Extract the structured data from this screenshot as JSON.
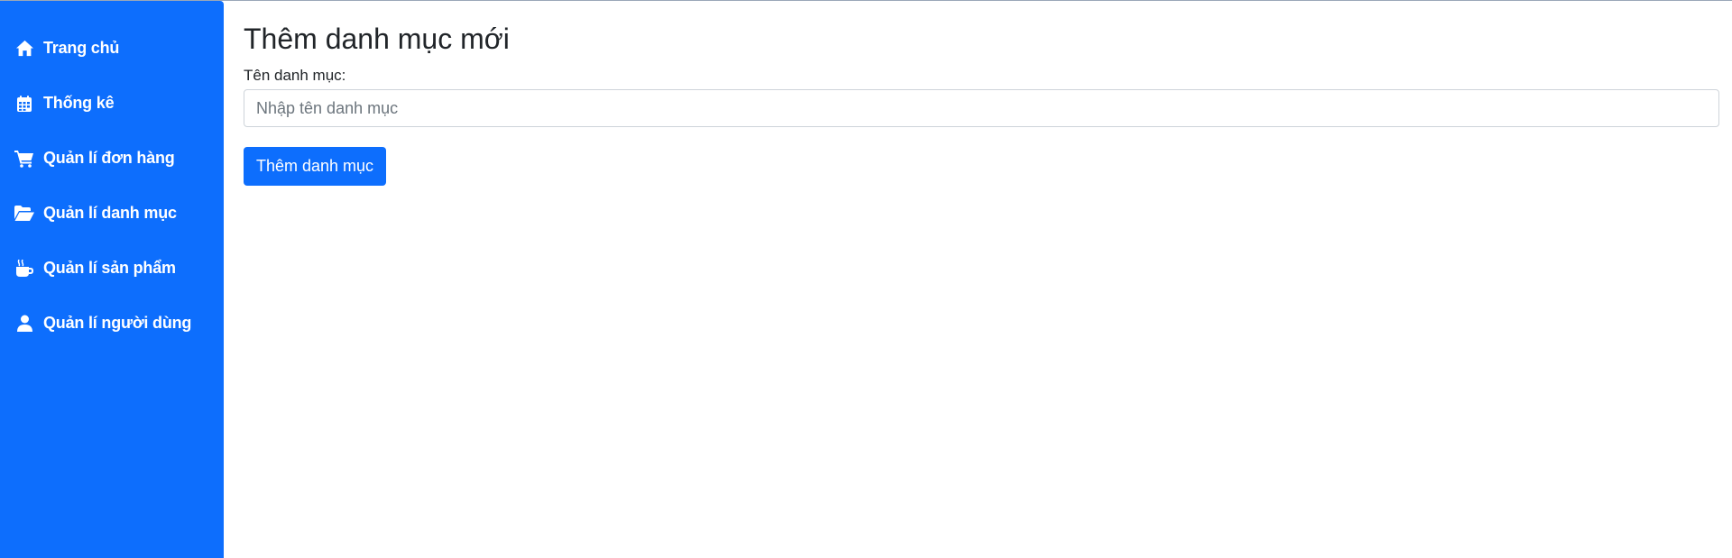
{
  "sidebar": {
    "background": "#0d6efd",
    "items": [
      {
        "label": "Trang chủ",
        "icon": "home-icon"
      },
      {
        "label": "Thống kê",
        "icon": "calendar-icon"
      },
      {
        "label": "Quản lí đơn hàng",
        "icon": "cart-icon"
      },
      {
        "label": "Quản lí danh mục",
        "icon": "folder-open-icon"
      },
      {
        "label": "Quản lí sản phẩm",
        "icon": "mug-icon"
      },
      {
        "label": "Quản lí người dùng",
        "icon": "user-icon"
      }
    ]
  },
  "main": {
    "title": "Thêm danh mục mới",
    "form": {
      "label": "Tên danh mục:",
      "input_value": "",
      "input_placeholder": "Nhập tên danh mục",
      "submit_label": "Thêm danh mục"
    }
  },
  "colors": {
    "accent": "#0d6efd",
    "text": "#212529",
    "placeholder": "#6c757d",
    "border": "#ced4da"
  }
}
